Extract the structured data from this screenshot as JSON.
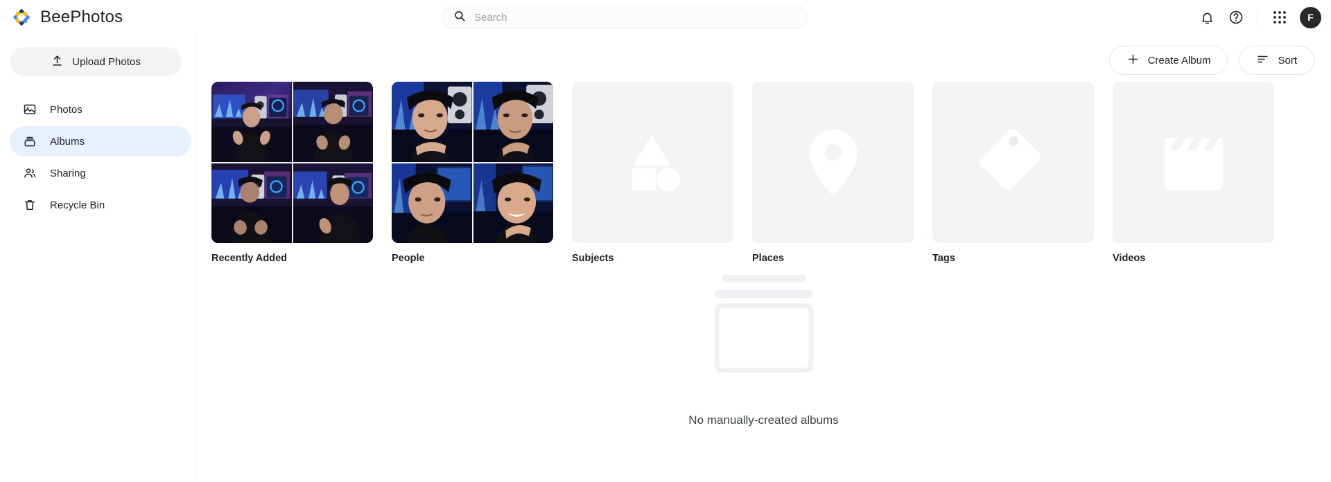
{
  "app": {
    "brand_name": "BeePhotos",
    "logo_colors": {
      "blue": "#4285f4",
      "yellow": "#fbbc04",
      "navy": "#1a2e6e"
    }
  },
  "header": {
    "search": {
      "placeholder": "Search",
      "value": "",
      "icon": "search-icon"
    },
    "actions": [
      {
        "name": "notifications-button",
        "icon": "bell-icon"
      },
      {
        "name": "help-button",
        "icon": "question-circle-icon"
      },
      {
        "name": "apps-button",
        "icon": "apps-grid-icon"
      }
    ],
    "avatar": {
      "initial": "F",
      "bg": "#26282b"
    }
  },
  "sidebar": {
    "upload": {
      "label": "Upload Photos",
      "icon": "upload-icon"
    },
    "items": [
      {
        "label": "Photos",
        "icon": "image-icon",
        "active": false
      },
      {
        "label": "Albums",
        "icon": "albums-icon",
        "active": true
      },
      {
        "label": "Sharing",
        "icon": "people-icon",
        "active": false
      },
      {
        "label": "Recycle Bin",
        "icon": "trash-icon",
        "active": false
      }
    ],
    "active_bg": "#e8f0fe"
  },
  "toolbar": {
    "create_album_label": "Create Album",
    "create_album_icon": "plus-icon",
    "sort_label": "Sort",
    "sort_icon": "sort-lines-icon"
  },
  "albums": [
    {
      "title": "Recently Added",
      "type": "photo-mosaic"
    },
    {
      "title": "People",
      "type": "photo-mosaic"
    },
    {
      "title": "Subjects",
      "type": "placeholder",
      "icon": "shapes-icon"
    },
    {
      "title": "Places",
      "type": "placeholder",
      "icon": "map-pin-icon"
    },
    {
      "title": "Tags",
      "type": "placeholder",
      "icon": "tag-icon"
    },
    {
      "title": "Videos",
      "type": "placeholder",
      "icon": "clapperboard-icon"
    }
  ],
  "empty_state": {
    "message": "No manually-created albums",
    "illustration": "empty-album-icon"
  }
}
